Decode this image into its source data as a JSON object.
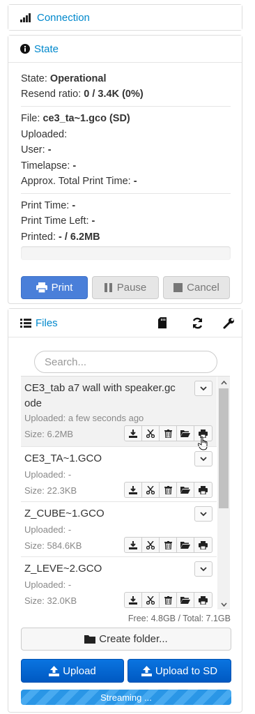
{
  "connection": {
    "title": "Connection"
  },
  "state": {
    "title": "State",
    "state_label": "State:",
    "state_value": "Operational",
    "resend_label": "Resend ratio:",
    "resend_value": "0 / 3.4K (0%)",
    "file_label": "File:",
    "file_value": "ce3_ta~1.gco (SD)",
    "uploaded_label": "Uploaded:",
    "user_label": "User:",
    "user_value": "-",
    "timelapse_label": "Timelapse:",
    "timelapse_value": "-",
    "approx_label": "Approx. Total Print Time:",
    "approx_value": "-",
    "print_time_label": "Print Time:",
    "print_time_value": "-",
    "time_left_label": "Print Time Left:",
    "time_left_value": "-",
    "printed_label": "Printed:",
    "printed_value": "- / 6.2MB",
    "progress_percent": 0,
    "buttons": {
      "print": "Print",
      "pause": "Pause",
      "cancel": "Cancel"
    }
  },
  "files": {
    "title": "Files",
    "search_placeholder": "Search...",
    "items": [
      {
        "name": "CE3_tab a7 wall with speaker.gc\node",
        "uploaded": "Uploaded: a few seconds ago",
        "size": "Size: 6.2MB"
      },
      {
        "name": "CE3_TA~1.GCO",
        "uploaded": "Uploaded: -",
        "size": "Size: 22.3KB"
      },
      {
        "name": "Z_CUBE~1.GCO",
        "uploaded": "Uploaded: -",
        "size": "Size: 584.6KB"
      },
      {
        "name": "Z_LEVE~2.GCO",
        "uploaded": "Uploaded: -",
        "size": "Size: 32.0KB"
      }
    ],
    "free_total": "Free: 4.8GB / Total: 7.1GB",
    "create_folder": "Create folder...",
    "upload": "Upload",
    "upload_sd": "Upload to SD",
    "streaming": "Streaming ..."
  },
  "colors": {
    "link": "#0088cc",
    "primary": "#4a7fd9",
    "upload": "#0a6ad6"
  }
}
